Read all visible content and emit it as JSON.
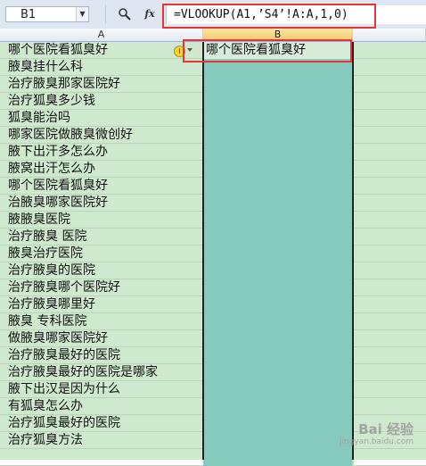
{
  "formula_bar": {
    "name_box": "B1",
    "formula": "=VLOOKUP(A1,’S4’!A:A,1,0)",
    "fx_label": "fx"
  },
  "columns": {
    "a": "A",
    "b": "B"
  },
  "rows": [
    {
      "a": "哪个医院看狐臭好",
      "b": "哪个医院看狐臭好"
    },
    {
      "a": "腋臭挂什么科",
      "b": ""
    },
    {
      "a": "治疗腋臭那家医院好",
      "b": ""
    },
    {
      "a": "治疗狐臭多少钱",
      "b": ""
    },
    {
      "a": "狐臭能治吗",
      "b": ""
    },
    {
      "a": "哪家医院做腋臭微创好",
      "b": ""
    },
    {
      "a": "腋下出汗多怎么办",
      "b": ""
    },
    {
      "a": "腋窝出汗怎么办",
      "b": ""
    },
    {
      "a": "哪个医院看狐臭好",
      "b": ""
    },
    {
      "a": "治腋臭哪家医院好",
      "b": ""
    },
    {
      "a": "腋腋臭医院",
      "b": ""
    },
    {
      "a": "治疗腋臭 医院",
      "b": ""
    },
    {
      "a": "腋臭治疗医院",
      "b": ""
    },
    {
      "a": "治疗腋臭的医院",
      "b": ""
    },
    {
      "a": "治疗腋臭哪个医院好",
      "b": ""
    },
    {
      "a": "治疗腋臭哪里好",
      "b": ""
    },
    {
      "a": "腋臭 专科医院",
      "b": ""
    },
    {
      "a": "做腋臭哪家医院好",
      "b": ""
    },
    {
      "a": "治疗腋臭最好的医院",
      "b": ""
    },
    {
      "a": "治疗腋臭最好的医院是哪家",
      "b": ""
    },
    {
      "a": "腋下出汉是因为什么",
      "b": ""
    },
    {
      "a": "有狐臭怎么办",
      "b": ""
    },
    {
      "a": "治疗狐臭最好的医院",
      "b": ""
    },
    {
      "a": "治疗狐臭方法",
      "b": ""
    },
    {
      "a": "",
      "b": ""
    }
  ],
  "watermark": {
    "title": "Bai 经验",
    "sub": "jingyan.baidu.com"
  }
}
